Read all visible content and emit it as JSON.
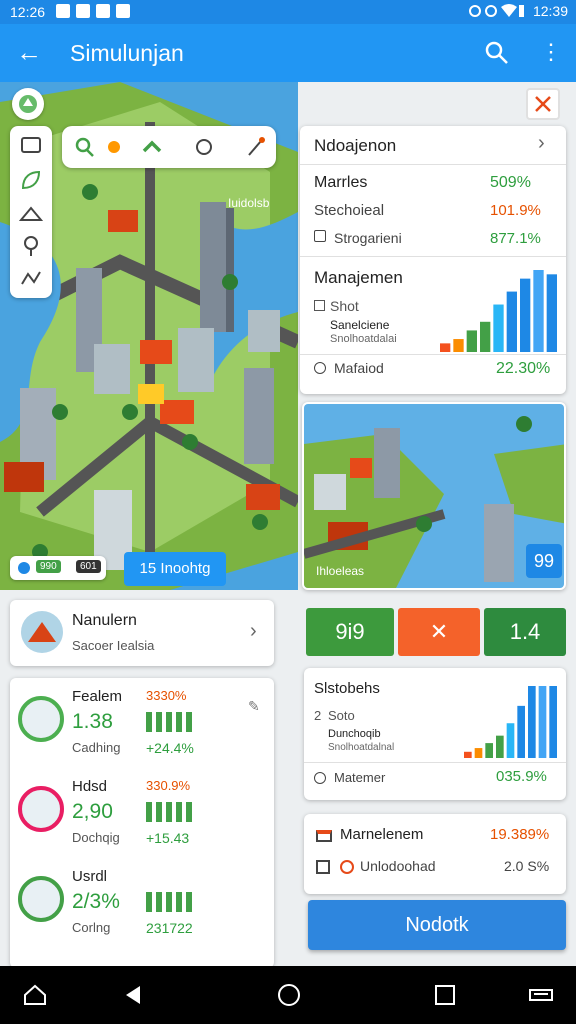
{
  "status_bar": {
    "time": "12:26",
    "clock": "12:39"
  },
  "app_bar": {
    "title": "Simulunjan"
  },
  "map": {
    "label": "Iuidolsb",
    "chip_left_tag1": "990",
    "chip_left_tag2": "601",
    "chip_right": "15 Inoohtg"
  },
  "top_card": {
    "header": "Ndoajenon",
    "rows": [
      {
        "label": "Marrles",
        "value": "509%"
      },
      {
        "label": "Stechoieal",
        "value": "101.9%"
      },
      {
        "label": "Strogarieni",
        "value": "877.1%"
      }
    ],
    "section_title": "Manajemen",
    "items": [
      "Shot",
      "Sanelciene",
      "Snolhoatdalai"
    ],
    "footer_label": "Mafaiod",
    "footer_value": "22.30%",
    "bars": [
      4,
      6,
      10,
      14,
      22,
      28,
      34,
      38,
      36
    ]
  },
  "photo_card": {
    "label": "Ihloeleas",
    "badge": "99"
  },
  "tiles": {
    "left": "9i9",
    "middle": "✕",
    "right": "1.4"
  },
  "second_card": {
    "title": "Slstobehs",
    "items": [
      "Soto",
      "Dunchoqib",
      "Snolhoatdalnal"
    ],
    "item_prefix": "2",
    "footer_label": "Matemer",
    "footer_value": "035.9%",
    "bars": [
      5,
      8,
      12,
      18,
      28,
      42,
      58,
      58,
      58
    ]
  },
  "third_card": {
    "row1_label": "Marnelenem",
    "row1_value": "19.389%",
    "row2_label": "Unlodoohad",
    "row2_value": "2.0 S%"
  },
  "primary_button": "Nodotk",
  "profile_card": {
    "name": "Nanulern",
    "subtitle": "Sacoer Iealsia"
  },
  "stats": [
    {
      "title": "Fealem",
      "pct": "3330%",
      "value": "1.38",
      "sub": "Cadhing",
      "sub_value": "+24.4%",
      "ring_color": "#4caf50"
    },
    {
      "title": "Hdsd",
      "pct": "330.9%",
      "value": "2,90",
      "sub": "Dochqig",
      "sub_value": "+15.43",
      "ring_color": "#e91e63"
    },
    {
      "title": "Usrdl",
      "pct": "",
      "value": "2/3%",
      "sub": "Corlng",
      "sub_value": "231722",
      "ring_color": "#43a047"
    }
  ],
  "colors": {
    "accent": "#2196f3",
    "green": "#43a047",
    "orange": "#f4511e"
  }
}
